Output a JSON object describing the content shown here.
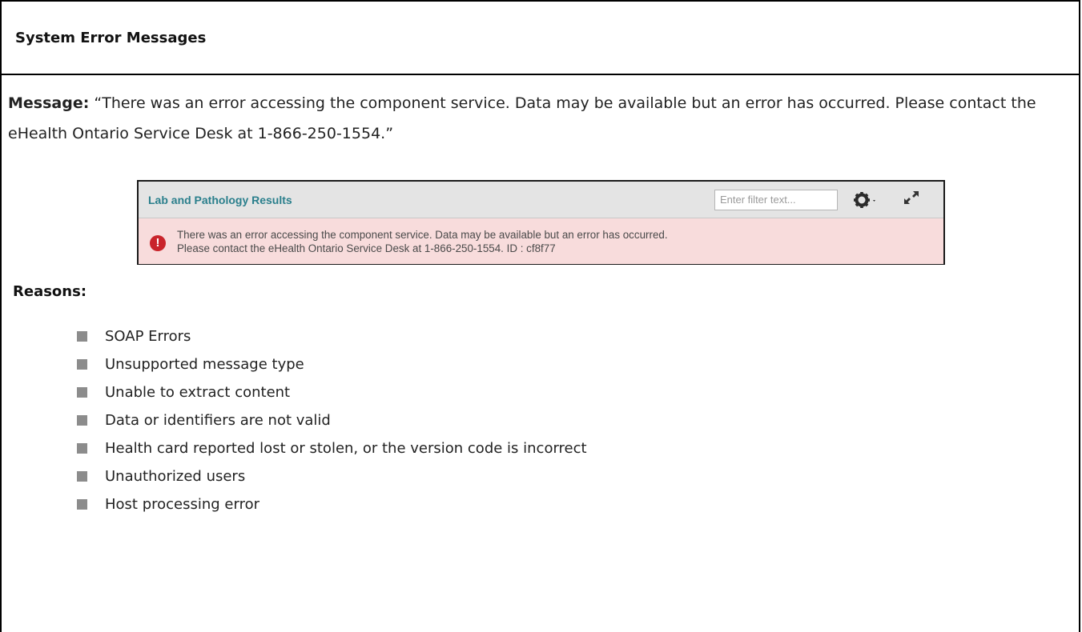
{
  "header": {
    "title": "System Error Messages"
  },
  "message": {
    "label": "Message:",
    "text": " “There was an error accessing the component service. Data may be available but an error has occurred.  Please contact the eHealth Ontario Service Desk at 1-866-250-1554.”"
  },
  "widget": {
    "title": "Lab and Pathology Results",
    "filter_placeholder": "Enter filter text...",
    "gear_icon": "gear-icon",
    "expand_icon": "expand-icon",
    "error_icon": "error-exclamation-icon",
    "error_color": "#c9242b",
    "error_background": "#f8dcdc",
    "title_color": "#2a7f8c",
    "error_line1": "There was an error accessing the component service. Data may be available but an error has occurred.",
    "error_line2": "Please contact the eHealth Ontario Service Desk at 1-866-250-1554. ID : cf8f77"
  },
  "reasons": {
    "title": "Reasons:",
    "items": [
      "SOAP Errors",
      "Unsupported message type",
      "Unable to extract content",
      "Data or identifiers are not valid",
      "Health card reported lost or stolen, or the version code  is incorrect",
      "Unauthorized users",
      "Host processing error"
    ]
  }
}
